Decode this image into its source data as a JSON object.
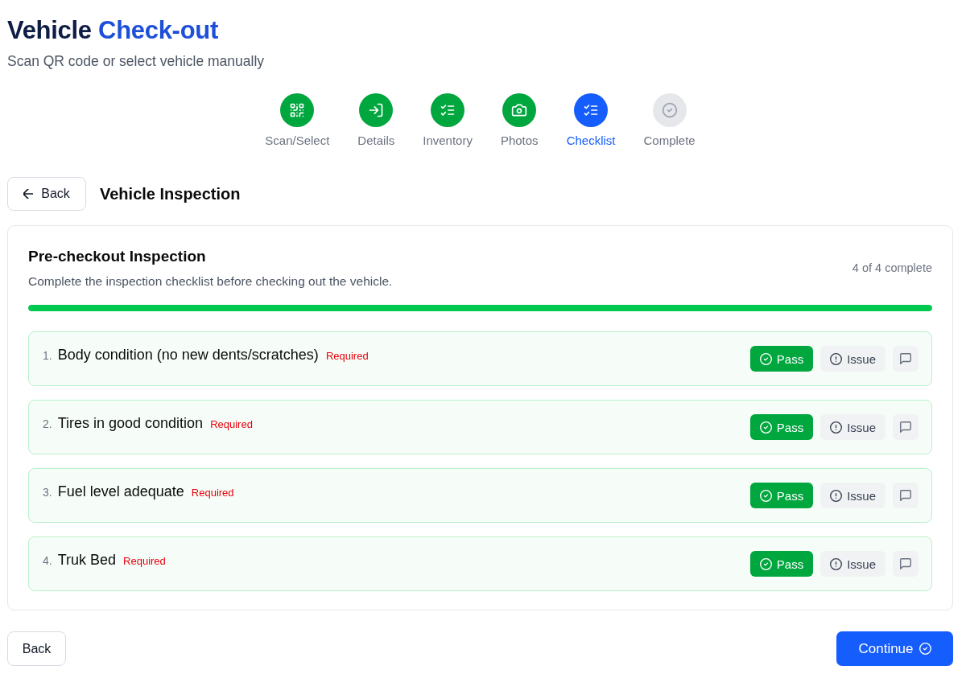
{
  "header": {
    "title": "Vehicle",
    "title_accent": "Check-out",
    "subtitle": "Scan QR code or select vehicle manually"
  },
  "steps": [
    {
      "label": "Scan/Select",
      "kind": "qr",
      "completed": true,
      "selected": false
    },
    {
      "label": "Details",
      "kind": "enter",
      "completed": true,
      "selected": false
    },
    {
      "label": "Inventory",
      "kind": "list",
      "completed": true,
      "selected": false
    },
    {
      "label": "Photos",
      "kind": "camera",
      "completed": true,
      "selected": false
    },
    {
      "label": "Checklist",
      "kind": "list",
      "completed": false,
      "selected": true
    },
    {
      "label": "Complete",
      "kind": "check",
      "completed": false,
      "selected": false
    }
  ],
  "section": {
    "back_label": "Back",
    "title": "Vehicle Inspection"
  },
  "card": {
    "title": "Pre-checkout Inspection",
    "description": "Complete the inspection checklist before checking out the vehicle.",
    "count": "4 of 4 complete",
    "progress": {
      "level": 1
    }
  },
  "items": [
    {
      "number": "1.",
      "label": "Body condition (no new dents/scratches)",
      "tag": "Required",
      "buttons": [
        {
          "label": "Pass",
          "kind": "pass",
          "selected": true
        },
        {
          "label": "Issue",
          "kind": "issue",
          "selected": false
        }
      ]
    },
    {
      "number": "2.",
      "label": "Tires in good condition",
      "tag": "Required",
      "buttons": [
        {
          "label": "Pass",
          "kind": "pass",
          "selected": true
        },
        {
          "label": "Issue",
          "kind": "issue",
          "selected": false
        }
      ]
    },
    {
      "number": "3.",
      "label": "Fuel level adequate",
      "tag": "Required",
      "buttons": [
        {
          "label": "Pass",
          "kind": "pass",
          "selected": true
        },
        {
          "label": "Issue",
          "kind": "issue",
          "selected": false
        }
      ]
    },
    {
      "number": "4.",
      "label": "Truk Bed",
      "tag": "Required",
      "buttons": [
        {
          "label": "Pass",
          "kind": "pass",
          "selected": true
        },
        {
          "label": "Issue",
          "kind": "issue",
          "selected": false
        }
      ]
    }
  ],
  "footer": {
    "back_label": "Back",
    "continue_label": "Continue"
  }
}
